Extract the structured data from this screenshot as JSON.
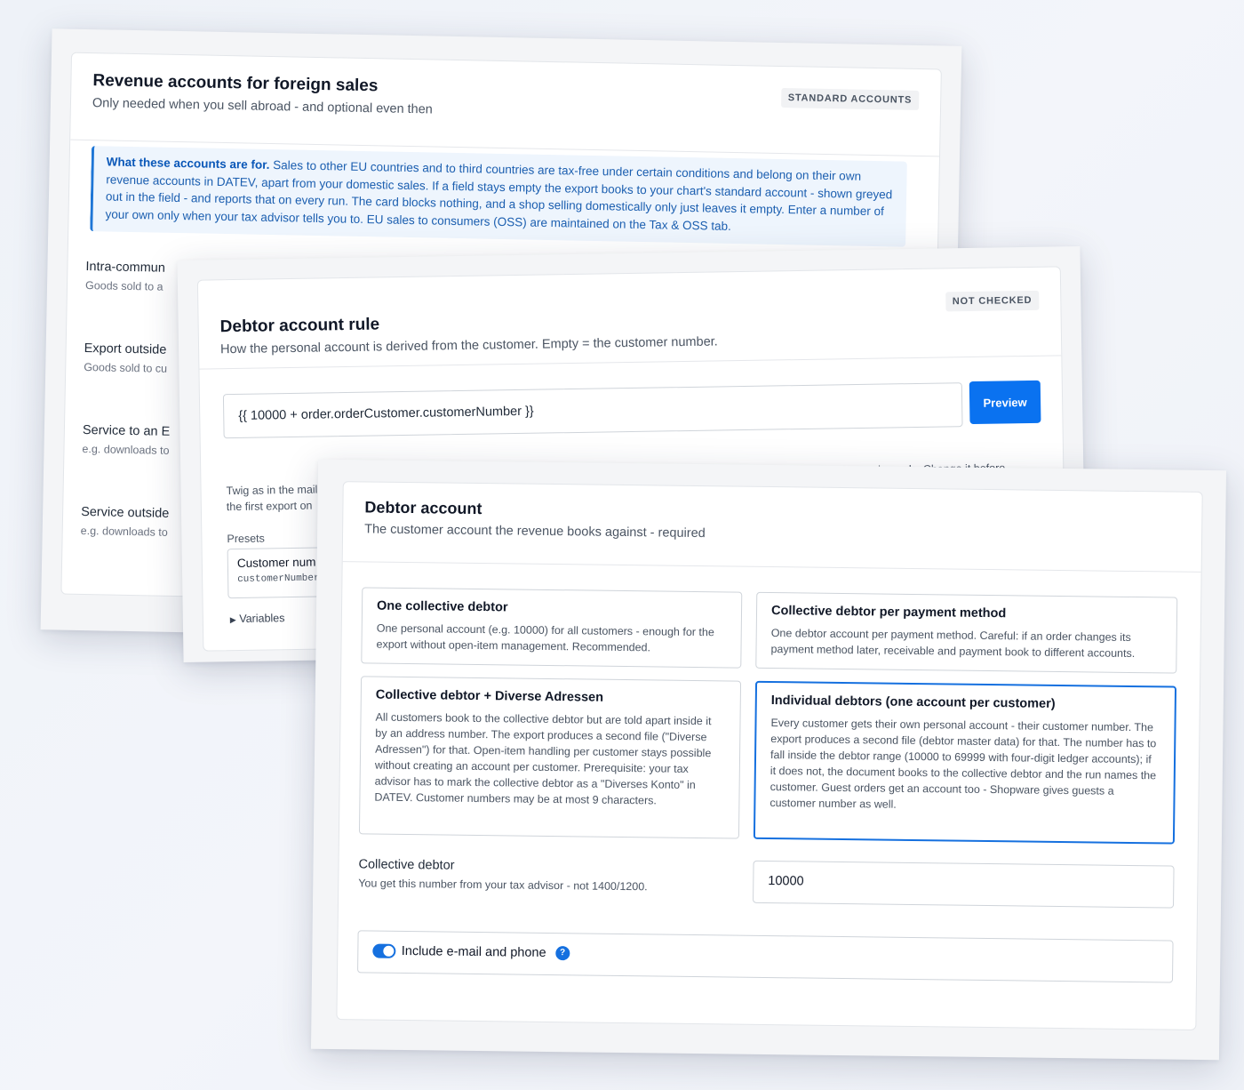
{
  "foreign_sales": {
    "title": "Revenue accounts for foreign sales",
    "subtitle": "Only needed when you sell abroad - and optional even then",
    "badge": "STANDARD ACCOUNTS",
    "info_lead": "What these accounts are for.",
    "info_text": "Sales to other EU countries and to third countries are tax-free under certain conditions and belong on their own revenue accounts in DATEV, apart from your domestic sales. If a field stays empty the export books to your chart's standard account - shown greyed out in the field - and reports that on every run. The card blocks nothing, and a shop selling domestically only just leaves it empty. Enter a number of your own only when your tax advisor tells you to. EU sales to consumers (OSS) are maintained on the Tax & OSS tab.",
    "rows": [
      {
        "label": "Intra-commun",
        "help": "Goods sold to a"
      },
      {
        "label": "Export outside",
        "help": "Goods sold to cu"
      },
      {
        "label": "Service to an E",
        "help": "e.g. downloads to"
      },
      {
        "label": "Service outside",
        "help": "e.g. downloads to"
      }
    ]
  },
  "debtor_rule": {
    "title": "Debtor account rule",
    "subtitle": "How the personal account is derived from the customer. Empty = the customer number.",
    "badge": "NOT CHECKED",
    "rule_value": "{{ 10000 + order.orderCustomer.customerNumber }}",
    "preview_label": "Preview",
    "twig_note_line1": "Twig as in the mail",
    "twig_note_line2": "the first export on",
    "right_note": "... of your channels. Change it before",
    "presets_label": "Presets",
    "preset_name": "Customer num",
    "preset_code": "customerNumber",
    "variables_label": "Variables",
    "variables_arrow": "▶"
  },
  "debtor_account": {
    "title": "Debtor account",
    "subtitle": "The customer account the revenue books against - required",
    "options": [
      {
        "title": "One collective debtor",
        "desc": "One personal account (e.g. 10000) for all customers - enough for the export without open-item management. Recommended."
      },
      {
        "title": "Collective debtor per payment method",
        "desc": "One debtor account per payment method. Careful: if an order changes its payment method later, receivable and payment book to different accounts."
      },
      {
        "title": "Collective debtor + Diverse Adressen",
        "desc": "All customers book to the collective debtor but are told apart inside it by an address number. The export produces a second file (\"Diverse Adressen\") for that. Open-item handling per customer stays possible without creating an account per customer. Prerequisite: your tax advisor has to mark the collective debtor as a \"Diverses Konto\" in DATEV. Customer numbers may be at most 9 characters."
      },
      {
        "title": "Individual debtors (one account per customer)",
        "desc": "Every customer gets their own personal account - their customer number. The export produces a second file (debtor master data) for that. The number has to fall inside the debtor range (10000 to 69999 with four-digit ledger accounts); if it does not, the document books to the collective debtor and the run names the customer. Guest orders get an account too - Shopware gives guests a customer number as well."
      }
    ],
    "selected_option": "Individual debtors (one account per customer)",
    "collective_label": "Collective debtor",
    "collective_help": "You get this number from your tax advisor - not 1400/1200.",
    "collective_value": "10000",
    "include_label": "Include e-mail and phone",
    "include_enabled": true,
    "help_glyph": "?"
  },
  "colors": {
    "accent": "#0a72f0",
    "selected_border": "#1570df",
    "info_bg": "#eef5fd"
  }
}
